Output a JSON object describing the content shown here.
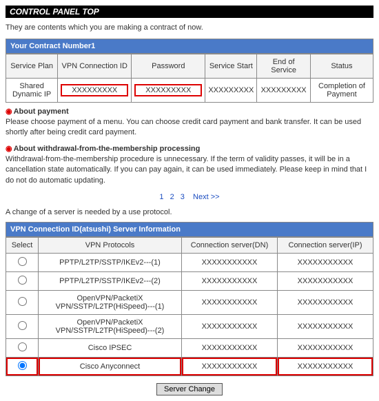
{
  "page_title": "CONTROL PANEL TOP",
  "intro": "They are contents which you are making a contract of now.",
  "contract": {
    "caption": "Your Contract Number1",
    "headers": [
      "Service Plan",
      "VPN Connection ID",
      "Password",
      "Service Start",
      "End of Service",
      "Status"
    ],
    "row": {
      "plan": "Shared Dynamic IP",
      "vpnid": "XXXXXXXXX",
      "password": "XXXXXXXXX",
      "start": "XXXXXXXXX",
      "end": "XXXXXXXXX",
      "status": "Completion of Payment"
    }
  },
  "about_payment": {
    "title": "About payment",
    "body": "Please choose payment of a menu. You can choose credit card payment and bank transfer. It can be used shortly after being credit card payment."
  },
  "about_withdrawal": {
    "title": "About withdrawal-from-the-membership processing",
    "body": "Withdrawal-from-the-membership procedure is unnecessary. If the term of validity passes, it will be in a cancellation state automatically. If you can pay again, it can be used immediately. Please keep in mind that I do not do automatic updating."
  },
  "pager": {
    "p1": "1",
    "p2": "2",
    "p3": "3",
    "next": "Next >>"
  },
  "change_note": "A change of a server is needed by a use protocol.",
  "server_info": {
    "caption": "VPN Connection ID(atsushi) Server Information",
    "headers": [
      "Select",
      "VPN Protocols",
      "Connection server(DN)",
      "Connection server(IP)"
    ],
    "rows": [
      {
        "protocol": "PPTP/L2TP/SSTP/IKEv2---(1)",
        "dn": "XXXXXXXXXXX",
        "ip": "XXXXXXXXXXX",
        "selected": false
      },
      {
        "protocol": "PPTP/L2TP/SSTP/IKEv2---(2)",
        "dn": "XXXXXXXXXXX",
        "ip": "XXXXXXXXXXX",
        "selected": false
      },
      {
        "protocol": "OpenVPN/PacketiX VPN/SSTP/L2TP(HiSpeed)---(1)",
        "dn": "XXXXXXXXXXX",
        "ip": "XXXXXXXXXXX",
        "selected": false
      },
      {
        "protocol": "OpenVPN/PacketiX VPN/SSTP/L2TP(HiSpeed)---(2)",
        "dn": "XXXXXXXXXXX",
        "ip": "XXXXXXXXXXX",
        "selected": false
      },
      {
        "protocol": "Cisco IPSEC",
        "dn": "XXXXXXXXXXX",
        "ip": "XXXXXXXXXXX",
        "selected": false
      },
      {
        "protocol": "Cisco Anyconnect",
        "dn": "XXXXXXXXXXX",
        "ip": "XXXXXXXXXXX",
        "selected": true
      }
    ]
  },
  "button_label": "Server Change"
}
